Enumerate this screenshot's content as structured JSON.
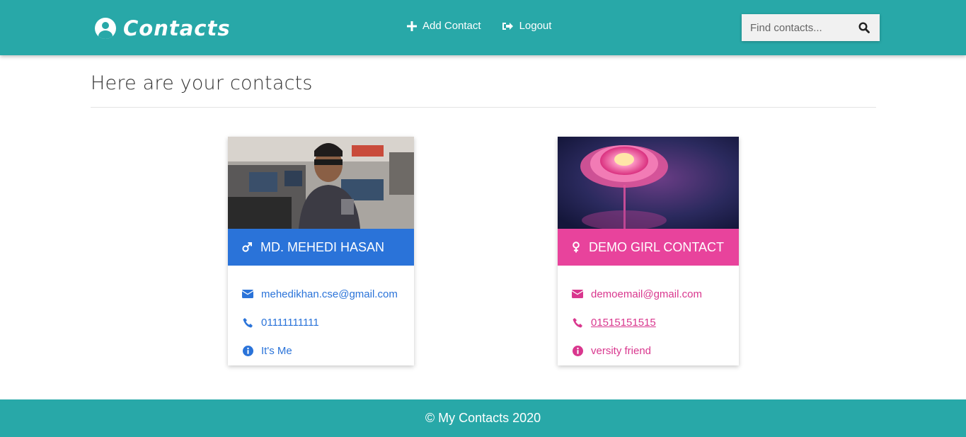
{
  "navbar": {
    "brand": "Contacts",
    "links": [
      {
        "label": "Add Contact",
        "icon": "plus-icon"
      },
      {
        "label": "Logout",
        "icon": "sign-out-icon"
      }
    ],
    "search": {
      "placeholder": "Find contacts...",
      "value": ""
    }
  },
  "main": {
    "title": "Here are your contacts"
  },
  "contacts": [
    {
      "name": "MD. MEHEDI HASAN",
      "gender_icon": "male-icon",
      "email": "mehedikhan.cse@gmail.com",
      "phone": "01111111111",
      "note": "It's Me",
      "color": "#2a73d9"
    },
    {
      "name": "DEMO GIRL CONTACT",
      "gender_icon": "female-icon",
      "email": "demoemail@gmail.com",
      "phone": "01515151515",
      "note": "versity friend",
      "color": "#e8439c"
    }
  ],
  "footer": {
    "text": "© My Contacts 2020"
  },
  "colors": {
    "primary": "#28a8a8",
    "male": "#2a73d9",
    "female": "#e8439c"
  }
}
